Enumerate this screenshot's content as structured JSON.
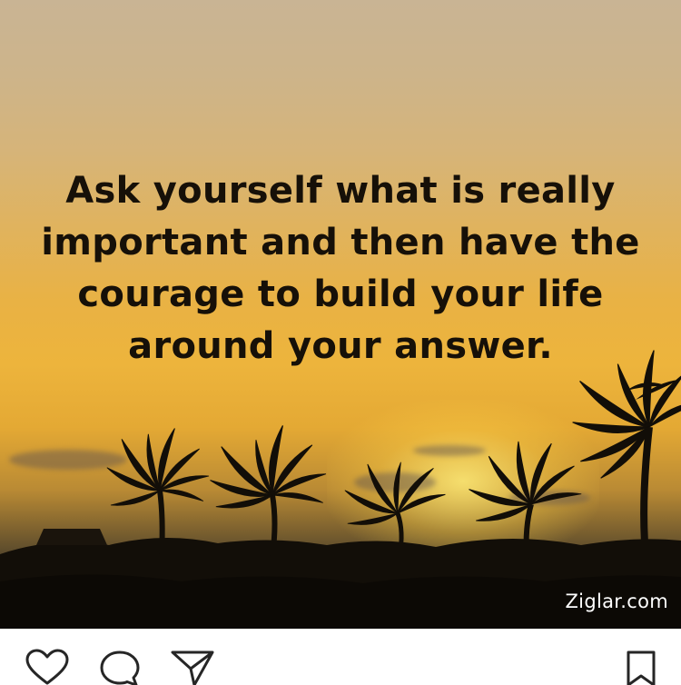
{
  "post": {
    "quote_lines": [
      "Ask yourself what is really",
      "important and then have the",
      "courage to build your life",
      "around your answer."
    ],
    "watermark": "Ziglar.com"
  },
  "actions": {
    "icons": [
      "heart-icon",
      "comment-icon",
      "share-icon",
      "bookmark-icon"
    ]
  },
  "colors": {
    "sky_top": "#c9b494",
    "sky_gold": "#edb43c",
    "silhouette": "#120e08",
    "text": "#161008",
    "icon_stroke": "#262626"
  }
}
